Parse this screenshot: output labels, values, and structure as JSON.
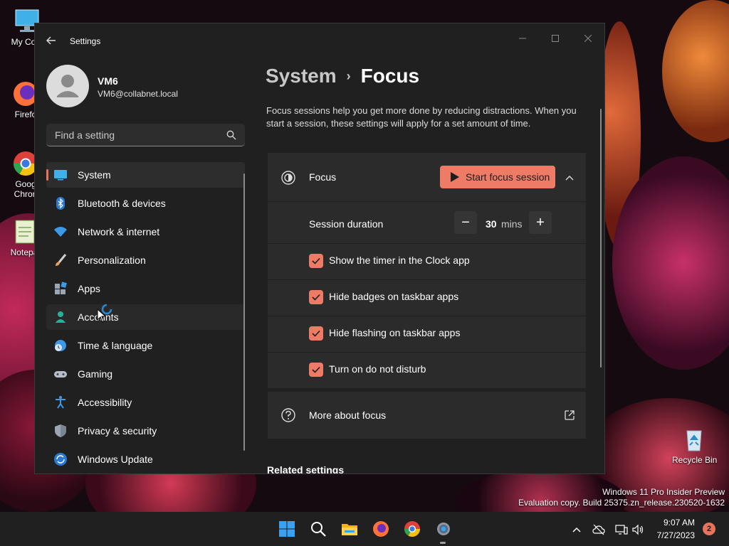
{
  "desktop": {
    "icons": [
      {
        "label": "My Com"
      },
      {
        "label": "Firefo"
      },
      {
        "label": "Goog",
        "label2": "Chron"
      },
      {
        "label": "Notepa"
      },
      {
        "label": "Recycle Bin"
      }
    ],
    "watermark": {
      "line1": "Windows 11 Pro Insider Preview",
      "line2": "Evaluation copy. Build 25375.zn_release.230520-1632"
    }
  },
  "window": {
    "title": "Settings",
    "profile": {
      "name": "VM6",
      "email": "VM6@collabnet.local"
    },
    "search": {
      "placeholder": "Find a setting",
      "value": ""
    },
    "nav": [
      {
        "label": "System",
        "icon": "monitor-icon",
        "selected": true
      },
      {
        "label": "Bluetooth & devices",
        "icon": "bluetooth-icon"
      },
      {
        "label": "Network & internet",
        "icon": "wifi-icon"
      },
      {
        "label": "Personalization",
        "icon": "brush-icon"
      },
      {
        "label": "Apps",
        "icon": "apps-icon"
      },
      {
        "label": "Accounts",
        "icon": "person-icon",
        "hover": true
      },
      {
        "label": "Time & language",
        "icon": "globe-clock-icon"
      },
      {
        "label": "Gaming",
        "icon": "gamepad-icon"
      },
      {
        "label": "Accessibility",
        "icon": "accessibility-icon"
      },
      {
        "label": "Privacy & security",
        "icon": "shield-icon"
      },
      {
        "label": "Windows Update",
        "icon": "update-icon"
      }
    ],
    "breadcrumb": {
      "parent": "System",
      "separator": "›",
      "current": "Focus"
    },
    "description": "Focus sessions help you get more done by reducing distractions. When you start a session, these settings will apply for a set amount of time.",
    "focus_card": {
      "title": "Focus",
      "start_button": "Start focus session",
      "duration": {
        "label": "Session duration",
        "value": "30",
        "unit": "mins",
        "minus": "−",
        "plus": "+"
      },
      "options": [
        {
          "label": "Show the timer in the Clock app",
          "checked": true
        },
        {
          "label": "Hide badges on taskbar apps",
          "checked": true
        },
        {
          "label": "Hide flashing on taskbar apps",
          "checked": true
        },
        {
          "label": "Turn on do not disturb",
          "checked": true
        }
      ]
    },
    "more_link": "More about focus",
    "related_heading": "Related settings"
  },
  "taskbar": {
    "clock": {
      "time": "9:07 AM",
      "date": "7/27/2023"
    },
    "notifications": "2"
  },
  "colors": {
    "accent": "#ee7b66",
    "window_bg": "#202020",
    "card_bg": "#2b2b2b"
  }
}
